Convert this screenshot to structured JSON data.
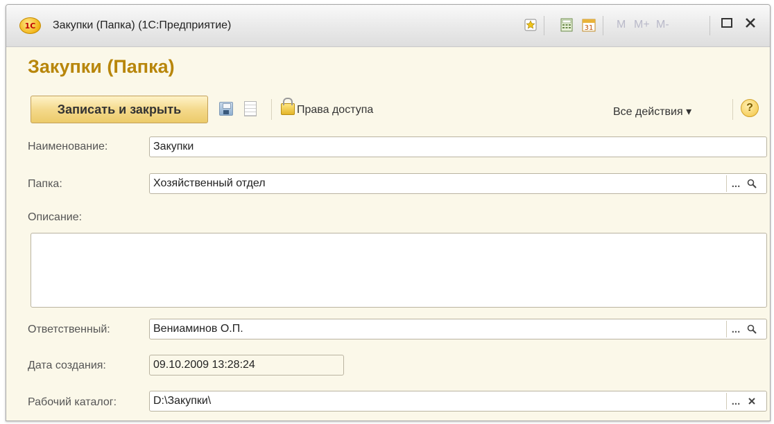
{
  "window": {
    "title": "Закупки (Папка)  (1С:Предприятие)",
    "logo": "1С",
    "toolbar_icons": [
      "favorites-icon",
      "calculator-icon",
      "calendar-icon"
    ],
    "memory_buttons": [
      "M",
      "M+",
      "M-"
    ],
    "calendar_day": "31"
  },
  "form": {
    "title": "Закупки (Папка)",
    "toolbar": {
      "save_close_label": "Записать и закрыть",
      "access_rights_label": "Права доступа",
      "all_actions_label": "Все действия ▾",
      "help_label": "?"
    },
    "fields": {
      "name": {
        "label": "Наименование:",
        "value": "Закупки"
      },
      "folder": {
        "label": "Папка:",
        "value": "Хозяйственный отдел"
      },
      "description": {
        "label": "Описание:",
        "value": ""
      },
      "responsible": {
        "label": "Ответственный:",
        "value": "Вениаминов О.П."
      },
      "created": {
        "label": "Дата создания:",
        "value": "09.10.2009 13:28:24"
      },
      "work_dir": {
        "label": "Рабочий каталог:",
        "value": "D:\\Закупки\\"
      }
    },
    "field_button_glyphs": {
      "select": "...",
      "open": "🔍",
      "clear": "✕"
    }
  },
  "colors": {
    "form_background": "#fbf8e9",
    "title_color": "#b8860b",
    "primary_button": "#f4d98c"
  }
}
